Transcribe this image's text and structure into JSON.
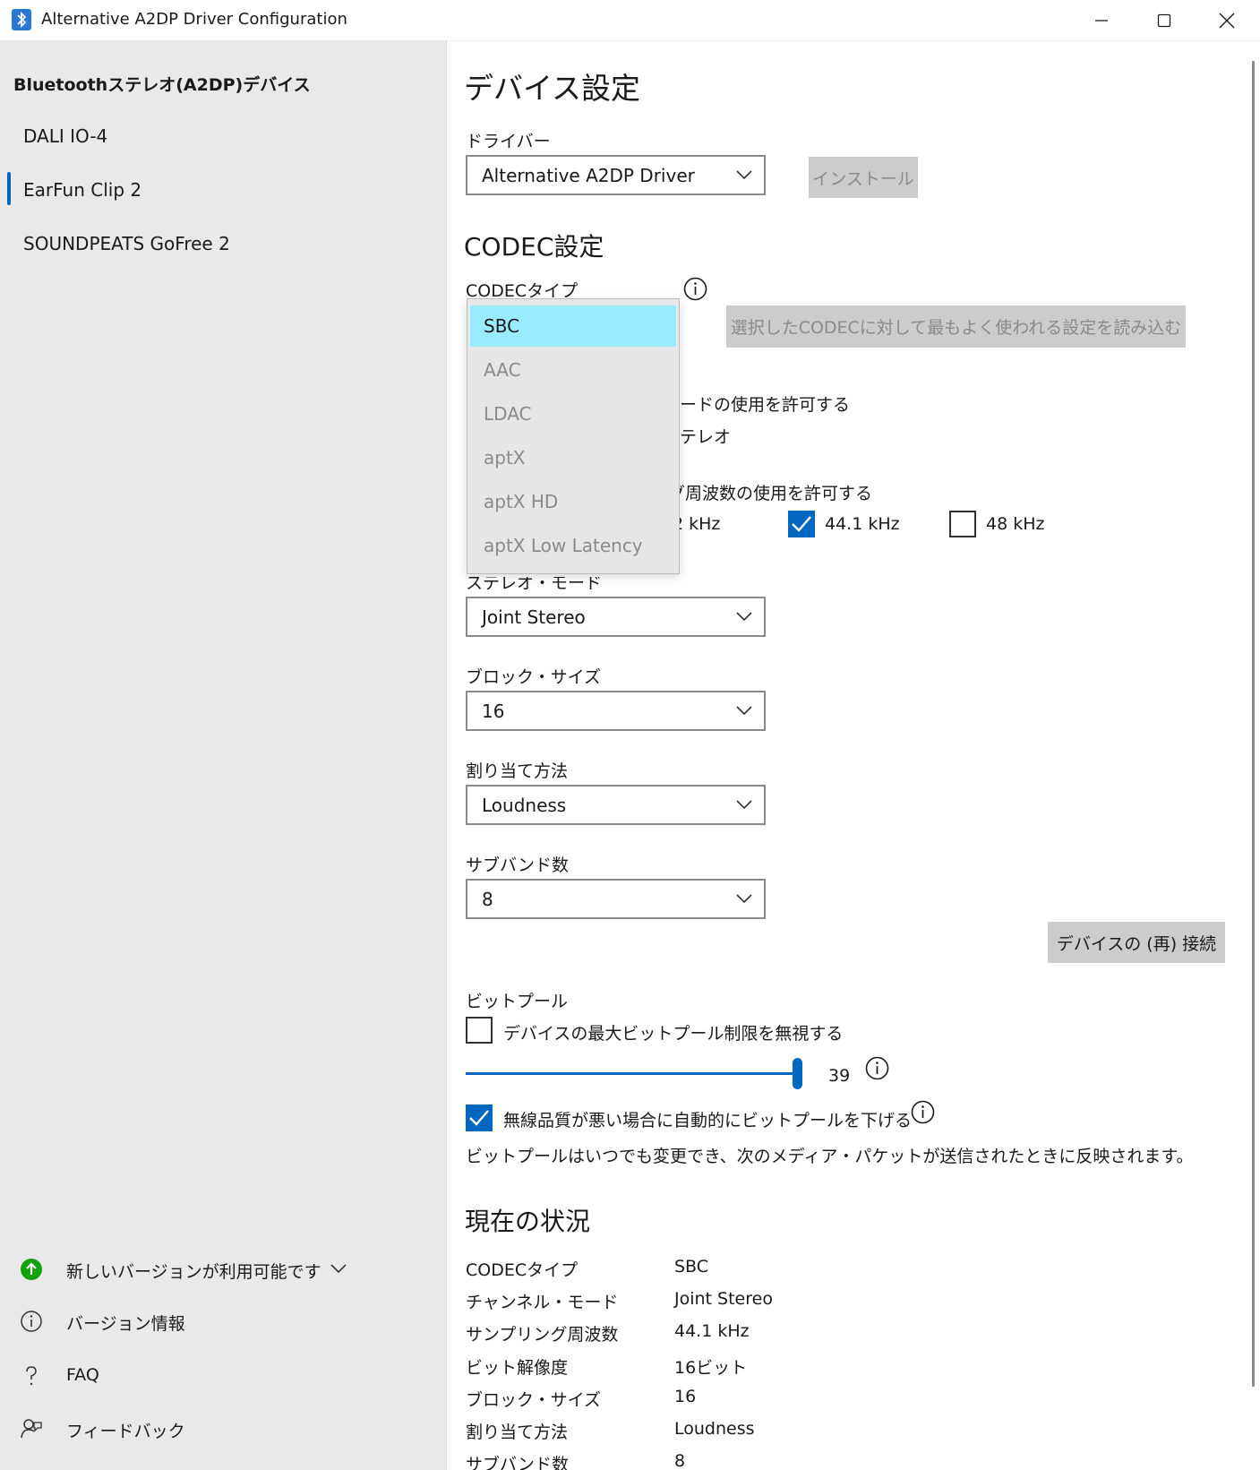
{
  "window": {
    "title": "Alternative A2DP Driver Configuration",
    "icon": "bluetooth-icon",
    "controls": [
      "minimize-icon",
      "maximize-icon",
      "close-icon"
    ]
  },
  "sidebar": {
    "header": "Bluetoothステレオ(A2DP)デバイス",
    "devices": [
      {
        "label": "DALI IO-4"
      },
      {
        "label": "EarFun Clip 2"
      },
      {
        "label": "SOUNDPEATS GoFree 2"
      }
    ],
    "selected_device": "EarFun Clip 2",
    "footer": [
      {
        "label": "新しいバージョンが利用可能です",
        "icon": "update-arrow-icon"
      },
      {
        "label": "バージョン情報",
        "icon": "info-icon"
      },
      {
        "label": "FAQ",
        "icon": "question-icon"
      },
      {
        "label": "フィードバック",
        "icon": "feedback-icon"
      }
    ]
  },
  "device_settings": {
    "title": "デバイス設定",
    "driver_label": "ドライバー",
    "driver_value": "Alternative A2DP Driver",
    "install_button": "インストール"
  },
  "codec_settings": {
    "title": "CODEC設定",
    "codec_type_label": "CODECタイプ",
    "load_common_button": "選択したCODECに対して最もよく使われる設定を読み込む",
    "dropdown_options": [
      "SBC",
      "AAC",
      "LDAC",
      "aptX",
      "aptX HD",
      "aptX Low Latency"
    ],
    "dropdown_selected": "SBC",
    "partial_allow_mode": "ードの使用を許可する",
    "partial_stereo": "テレオ",
    "partial_allow_freq": "グ周波数の使用を許可する",
    "partial_freq": "2 kHz",
    "freq_441": {
      "label": "44.1 kHz",
      "checked": true
    },
    "freq_48": {
      "label": "48 kHz",
      "checked": false
    },
    "stereo_mode_label": "ステレオ・モード",
    "stereo_mode_value": "Joint Stereo",
    "block_size_label": "ブロック・サイズ",
    "block_size_value": "16",
    "allocation_label": "割り当て方法",
    "allocation_value": "Loudness",
    "subbands_label": "サブバンド数",
    "subbands_value": "8",
    "reconnect_button": "デバイスの (再) 接続",
    "bitpool_label": "ビットプール",
    "ignore_max_bitpool": {
      "label": "デバイスの最大ビットプール制限を無視する",
      "checked": false
    },
    "bitpool_value": "39",
    "bitpool_slider_fraction": 1.0,
    "auto_lower": {
      "label": "無線品質が悪い場合に自動的にビットプールを下げる",
      "checked": true
    },
    "bitpool_note": "ビットプールはいつでも変更でき、次のメディア・パケットが送信されたときに反映されます。"
  },
  "current_status": {
    "title": "現在の状況",
    "rows": [
      {
        "key": "CODECタイプ",
        "value": "SBC"
      },
      {
        "key": "チャンネル・モード",
        "value": "Joint Stereo"
      },
      {
        "key": "サンプリング周波数",
        "value": "44.1 kHz"
      },
      {
        "key": "ビット解像度",
        "value": "16ビット"
      },
      {
        "key": "ブロック・サイズ",
        "value": "16"
      },
      {
        "key": "割り当て方法",
        "value": "Loudness"
      },
      {
        "key": "サブバンド数",
        "value": "8"
      }
    ]
  },
  "colors": {
    "accent": "#0067c0",
    "selection": "#99ebff",
    "sidebar_bg": "#e9e9e9",
    "update_green": "#13a10e"
  }
}
